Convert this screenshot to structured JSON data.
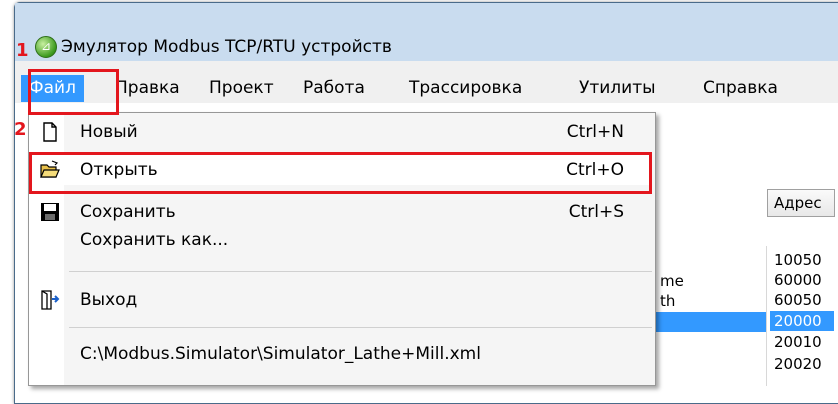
{
  "window": {
    "title": "Эмулятор Modbus TCP/RTU устройств"
  },
  "menu": {
    "items": [
      "Файл",
      "Правка",
      "Проект",
      "Работа",
      "Трассировка",
      "Утилиты",
      "Справка"
    ],
    "active_index": 0
  },
  "file_menu": {
    "items": [
      {
        "label": "Новый",
        "shortcut": "Ctrl+N",
        "icon": "new-file-icon"
      },
      {
        "label": "Открыть",
        "shortcut": "Ctrl+O",
        "icon": "open-folder-icon"
      },
      {
        "label": "Сохранить",
        "shortcut": "Ctrl+S",
        "icon": "save-disk-icon"
      },
      {
        "label": "Сохранить как...",
        "shortcut": "",
        "icon": ""
      },
      {
        "label": "Выход",
        "shortcut": "",
        "icon": "exit-door-icon"
      },
      {
        "label": "C:\\Modbus.Simulator\\Simulator_Lathe+Mill.xml",
        "shortcut": "",
        "icon": ""
      }
    ],
    "highlighted_index": 1
  },
  "annotations": {
    "step1": "1",
    "step2": "2"
  },
  "table": {
    "address_header": "Адрес",
    "partial_names": [
      "me",
      "th"
    ],
    "addresses": [
      "10050",
      "60000",
      "60050",
      "20000",
      "20010",
      "20020"
    ],
    "selected_row": 3
  },
  "colors": {
    "accent": "#3399ff",
    "annotation": "#e3161d"
  }
}
